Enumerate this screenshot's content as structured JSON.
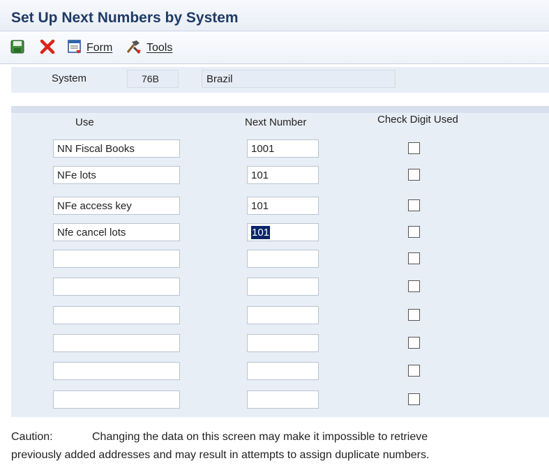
{
  "page": {
    "title": "Set Up Next Numbers by System"
  },
  "toolbar": {
    "save_icon": "save-icon",
    "cancel_icon": "close-x-icon",
    "form_label": "Form",
    "tools_label": "Tools"
  },
  "header": {
    "system_label": "System",
    "system_code": "76B",
    "system_desc": "Brazil"
  },
  "grid": {
    "col_use": "Use",
    "col_next": "Next Number",
    "col_check": "Check Digit Used",
    "rows": [
      {
        "use": "NN Fiscal Books",
        "next": "1001",
        "check": false
      },
      {
        "use": "NFe lots",
        "next": "101",
        "check": false
      },
      {
        "use": "NFe access key",
        "next": "101",
        "check": false
      },
      {
        "use": "Nfe cancel lots",
        "next": "101",
        "check": false,
        "selected": true
      },
      {
        "use": "",
        "next": "",
        "check": false
      },
      {
        "use": "",
        "next": "",
        "check": false
      },
      {
        "use": "",
        "next": "",
        "check": false
      },
      {
        "use": "",
        "next": "",
        "check": false
      },
      {
        "use": "",
        "next": "",
        "check": false
      },
      {
        "use": "",
        "next": "",
        "check": false
      }
    ]
  },
  "footer": {
    "caution_label": "Caution:",
    "caution_line1": "Changing the data on this screen may make it impossible to retrieve",
    "caution_line2": "previously added addresses and may result in attempts to assign duplicate numbers."
  },
  "colors": {
    "title": "#1f3b66",
    "panel": "#e8eef6",
    "selection": "#0a246a"
  }
}
